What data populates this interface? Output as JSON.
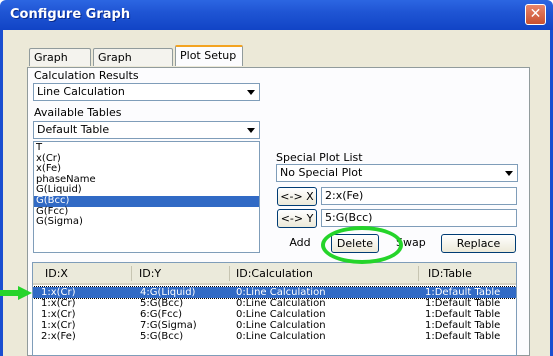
{
  "window": {
    "title": "Configure Graph",
    "close_glyph": "✕"
  },
  "tabs": [
    {
      "label": "Graph Axes"
    },
    {
      "label": "Graph Options"
    },
    {
      "label": "Plot Setup",
      "active": true
    }
  ],
  "calculation_results": {
    "label": "Calculation Results",
    "value": "Line Calculation"
  },
  "available_tables": {
    "label": "Available Tables",
    "value": "Default Table"
  },
  "variables": {
    "items": [
      "T",
      "x(Cr)",
      "x(Fe)",
      "phaseName",
      "G(Liquid)",
      "G(Bcc)",
      "G(Fcc)",
      "G(Sigma)"
    ],
    "selected_index": 5
  },
  "special_plot_list": {
    "label": "Special Plot List",
    "value": "No Special Plot"
  },
  "x_button": {
    "label": "<-> X",
    "value": "2:x(Fe)"
  },
  "y_button": {
    "label": "<-> Y",
    "value": "5:G(Bcc)"
  },
  "actions": {
    "add": "Add",
    "delete": "Delete",
    "swap": "Swap",
    "replace": "Replace"
  },
  "plot_table": {
    "columns": [
      "ID:X",
      "ID:Y",
      "ID:Calculation",
      "ID:Table"
    ],
    "rows": [
      [
        "1:x(Cr)",
        "4:G(Liquid)",
        "0:Line Calculation",
        "1:Default Table"
      ],
      [
        "1:x(Cr)",
        "5:G(Bcc)",
        "0:Line Calculation",
        "1:Default Table"
      ],
      [
        "1:x(Cr)",
        "6:G(Fcc)",
        "0:Line Calculation",
        "1:Default Table"
      ],
      [
        "1:x(Cr)",
        "7:G(Sigma)",
        "0:Line Calculation",
        "1:Default Table"
      ],
      [
        "2:x(Fe)",
        "5:G(Bcc)",
        "0:Line Calculation",
        "1:Default Table"
      ]
    ],
    "selected_row": 0
  },
  "annotations": {
    "highlight_color": "#25d42a"
  }
}
